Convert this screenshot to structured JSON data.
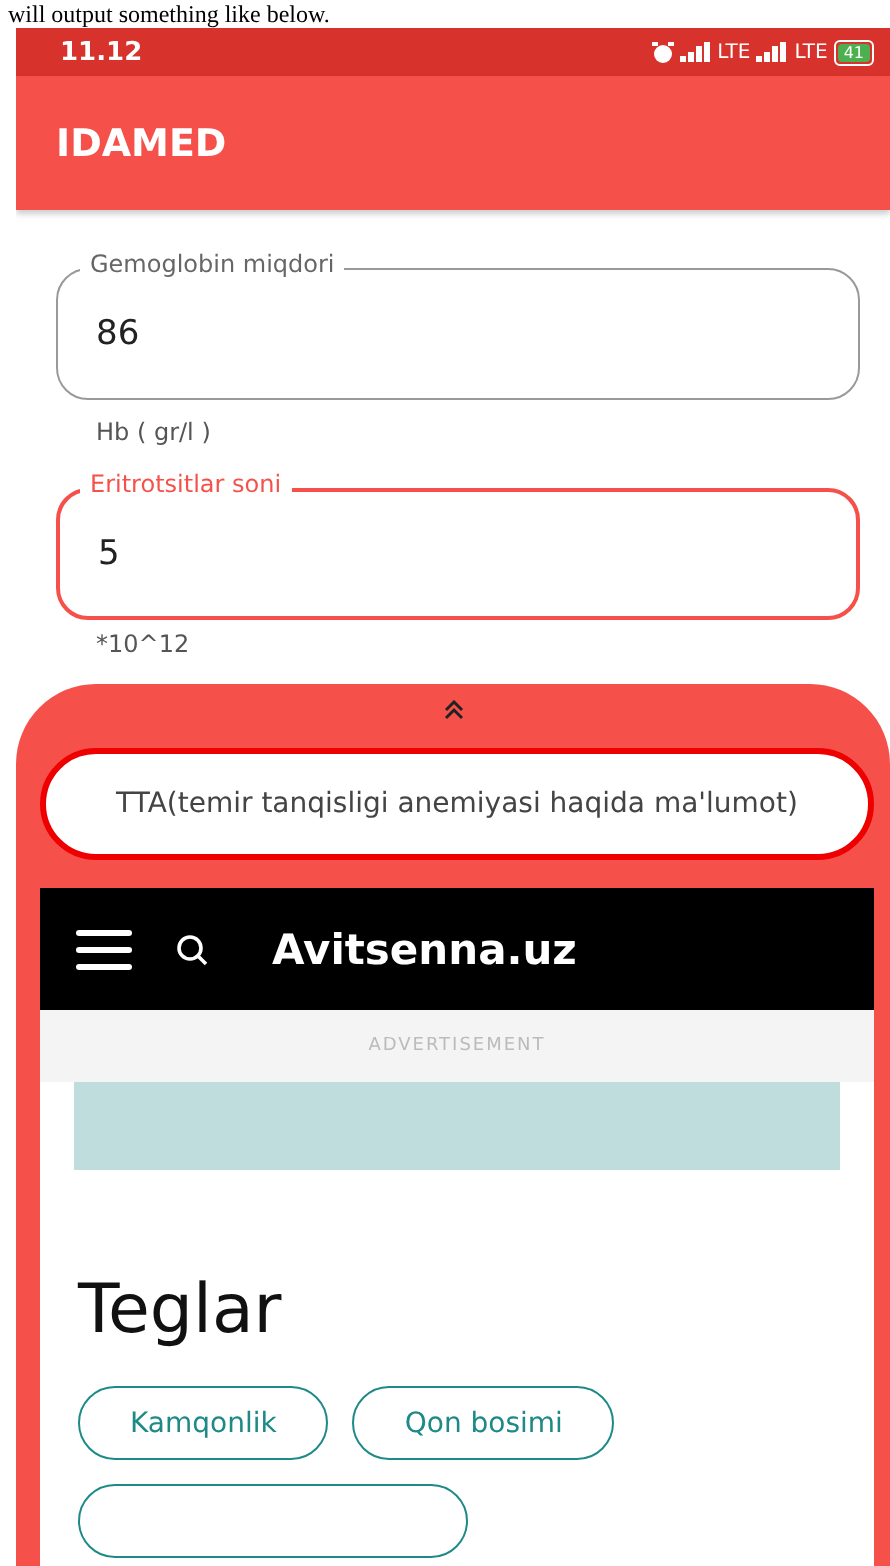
{
  "caption": "will output something like below.",
  "status_bar": {
    "time": "11.12",
    "network_1": "LTE",
    "network_2": "LTE",
    "battery": "41"
  },
  "app_bar": {
    "title": "IDAMED"
  },
  "fields": [
    {
      "label": "Gemoglobin miqdori",
      "value": "86",
      "helper": "Hb ( gr/l )",
      "focused": false
    },
    {
      "label": "Eritrotsitlar soni",
      "value": "5",
      "helper": "*10^12",
      "focused": true
    }
  ],
  "sheet": {
    "search": {
      "value": "TTA(temir tanqisligi anemiyasi haqida ma'lumot)"
    },
    "webview": {
      "site_title": "Avitsenna.uz",
      "ad_label": "ADVERTISEMENT",
      "heading": "Teglar",
      "tags": [
        {
          "kind": "labeled",
          "label": "Kamqonlik"
        },
        {
          "kind": "labeled",
          "label": "Qon bosimi"
        },
        {
          "kind": "blank"
        }
      ]
    }
  }
}
